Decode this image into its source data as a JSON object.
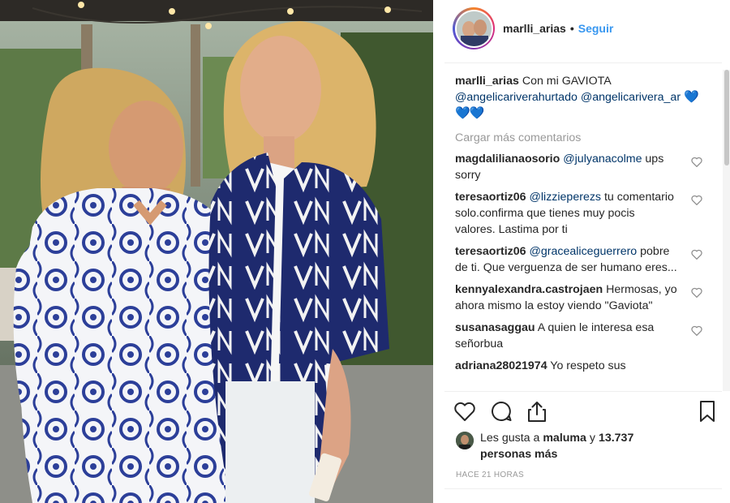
{
  "colors": {
    "accent": "#3897f0",
    "mention": "#003569",
    "muted": "#999999",
    "hearts": "#15b5c9"
  },
  "post": {
    "username": "marlli_arias",
    "dot": "•",
    "follow_label": "Seguir"
  },
  "caption": {
    "username": "marlli_arias",
    "text": "Con mi GAVIOTA",
    "mention1": "@angelicariverahurtado",
    "mention2": "@angelicarivera_ar",
    "emoji": "💙💙💙"
  },
  "load_more_label": "Cargar más comentarios",
  "comments": [
    {
      "user": "magdalilianaosorio",
      "mention": "@julyanacolme",
      "text": "ups sorry"
    },
    {
      "user": "teresaortiz06",
      "mention": "@lizzieperezs",
      "text": "tu comentario solo.confirma que tienes muy pocis valores. Lastima por ti"
    },
    {
      "user": "teresaortiz06",
      "mention": "@gracealiceguerrero",
      "text": "pobre de ti. Que verguenza de ser humano eres..."
    },
    {
      "user": "kennyalexandra.castrojaen",
      "mention": "",
      "text": "Hermosas, yo ahora mismo la estoy viendo \"Gaviota\""
    },
    {
      "user": "susanasaggau",
      "mention": "",
      "text": "A quien le interesa esa señorbua"
    },
    {
      "user": "adriana28021974",
      "mention": "",
      "text": "Yo respeto sus"
    }
  ],
  "actions": {
    "like_icon": "heart-outline-icon",
    "comment_icon": "comment-bubble-icon",
    "share_icon": "share-upload-icon",
    "save_icon": "bookmark-icon"
  },
  "likes": {
    "prefix": "Les gusta a",
    "user": "maluma",
    "connector": "y",
    "count_text": "13.737 personas más"
  },
  "timestamp": "HACE 21 HORAS"
}
